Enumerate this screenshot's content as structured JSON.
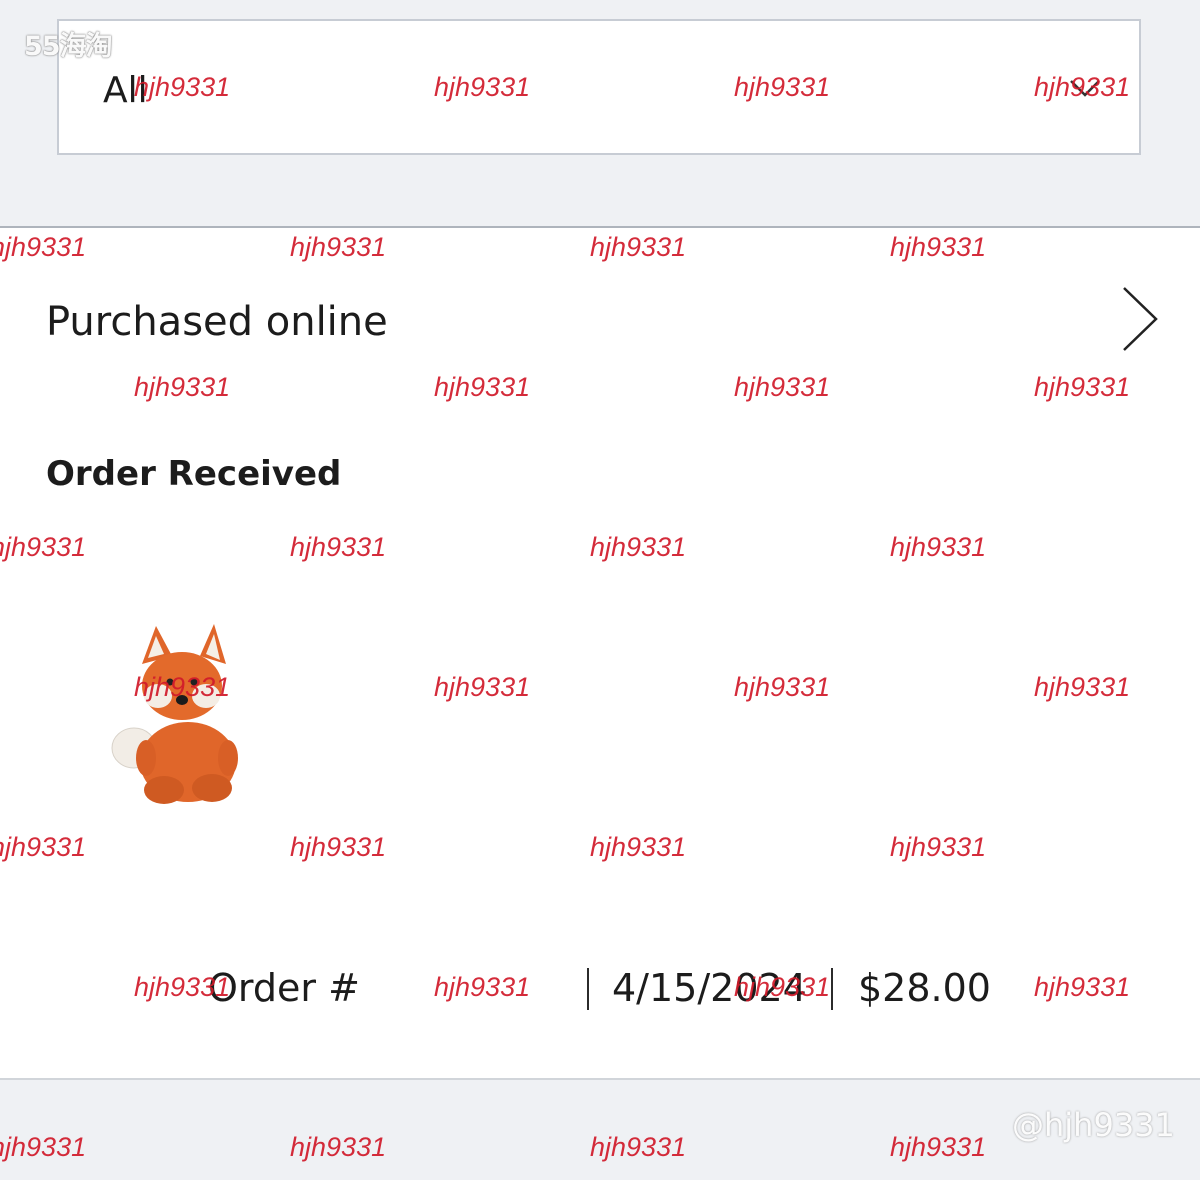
{
  "filter": {
    "selected_label": "All"
  },
  "purchase_section": {
    "label": "Purchased online"
  },
  "order": {
    "status": "Order Received",
    "number_label": "Order #",
    "date": "4/15/2024",
    "total": "$28.00",
    "product_image": "plush-fox-toy"
  },
  "overlay": {
    "brand_mark": "55海淘",
    "user_handle": "@hjh9331",
    "watermark_text": "hjh9331"
  },
  "colors": {
    "page_background": "#eff1f4",
    "card_background": "#ffffff",
    "watermark": "#d11a2a",
    "fox_orange": "#e0662a"
  }
}
